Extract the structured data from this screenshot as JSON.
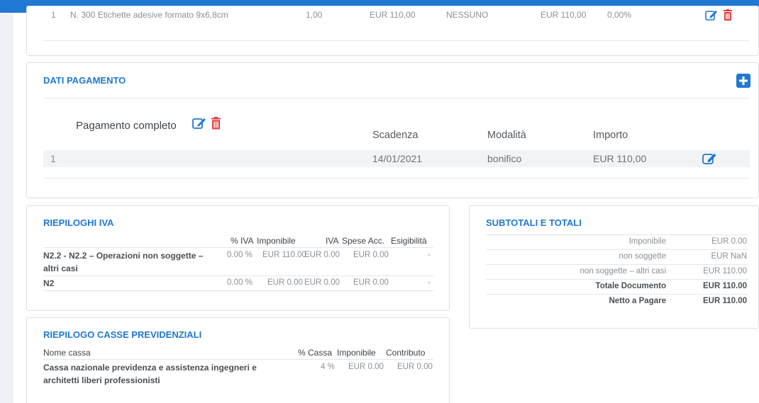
{
  "top_row": {
    "num": "1",
    "description": "N. 300 Etichette adesive formato 9x6,8cm",
    "quantity": "1,00",
    "price": "EUR 110,00",
    "discount": "NESSUNO",
    "total": "EUR 110,00",
    "vat": "0,00%"
  },
  "dati_pagamento": {
    "title": "DATI PAGAMENTO",
    "payment_label": "Pagamento completo",
    "headers": {
      "scadenza": "Scadenza",
      "modalita": "Modalità",
      "importo": "Importo"
    },
    "row": {
      "num": "1",
      "scadenza": "14/01/2021",
      "modalita": "bonifico",
      "importo": "EUR 110,00"
    }
  },
  "riepiloghi_iva": {
    "title": "RIEPILOGHI IVA",
    "headers": {
      "iva_pct": "% IVA",
      "imponibile": "Imponibile",
      "iva": "IVA",
      "spese": "Spese Acc.",
      "esigibilita": "Esigibilità"
    },
    "rows": [
      {
        "name_line1": "N2.2 - N2.2 – Operazioni non soggette –",
        "name_line2": "altri casi",
        "iva_pct": "0.00 %",
        "imponibile": "EUR 110.00",
        "iva": "EUR 0.00",
        "spese": "EUR 0.00",
        "esigibilita": "-"
      },
      {
        "name_line1": "N2",
        "name_line2": "",
        "iva_pct": "0.00 %",
        "imponibile": "EUR 0.00",
        "iva": "EUR 0.00",
        "spese": "EUR 0.00",
        "esigibilita": "-"
      }
    ]
  },
  "subtotali": {
    "title": "SUBTOTALI E TOTALI",
    "rows": [
      {
        "label": "Imponibile",
        "value": "EUR 0.00"
      },
      {
        "label": "non soggette",
        "value": "EUR NaN"
      },
      {
        "label": "non soggette – altri casi",
        "value": "EUR 110.00"
      },
      {
        "label": "Totale Documento",
        "value": "EUR 110.00"
      },
      {
        "label": "Netto a Pagare",
        "value": "EUR 110.00"
      }
    ]
  },
  "casse": {
    "title": "RIEPILOGO CASSE PREVIDENZIALI",
    "headers": {
      "nome": "Nome cassa",
      "pct": "% Cassa",
      "imponibile": "Imponibile",
      "contributo": "Contributo"
    },
    "row": {
      "name_line1": "Cassa nazionale previdenza e assistenza ingegneri e",
      "name_line2": "architetti liberi professionisti",
      "pct": "4 %",
      "imponibile": "EUR 0.00",
      "contributo": "EUR 0.00"
    }
  },
  "colors": {
    "accent": "#1f78d1",
    "danger": "#e03e3e",
    "muted": "#8a9096"
  }
}
